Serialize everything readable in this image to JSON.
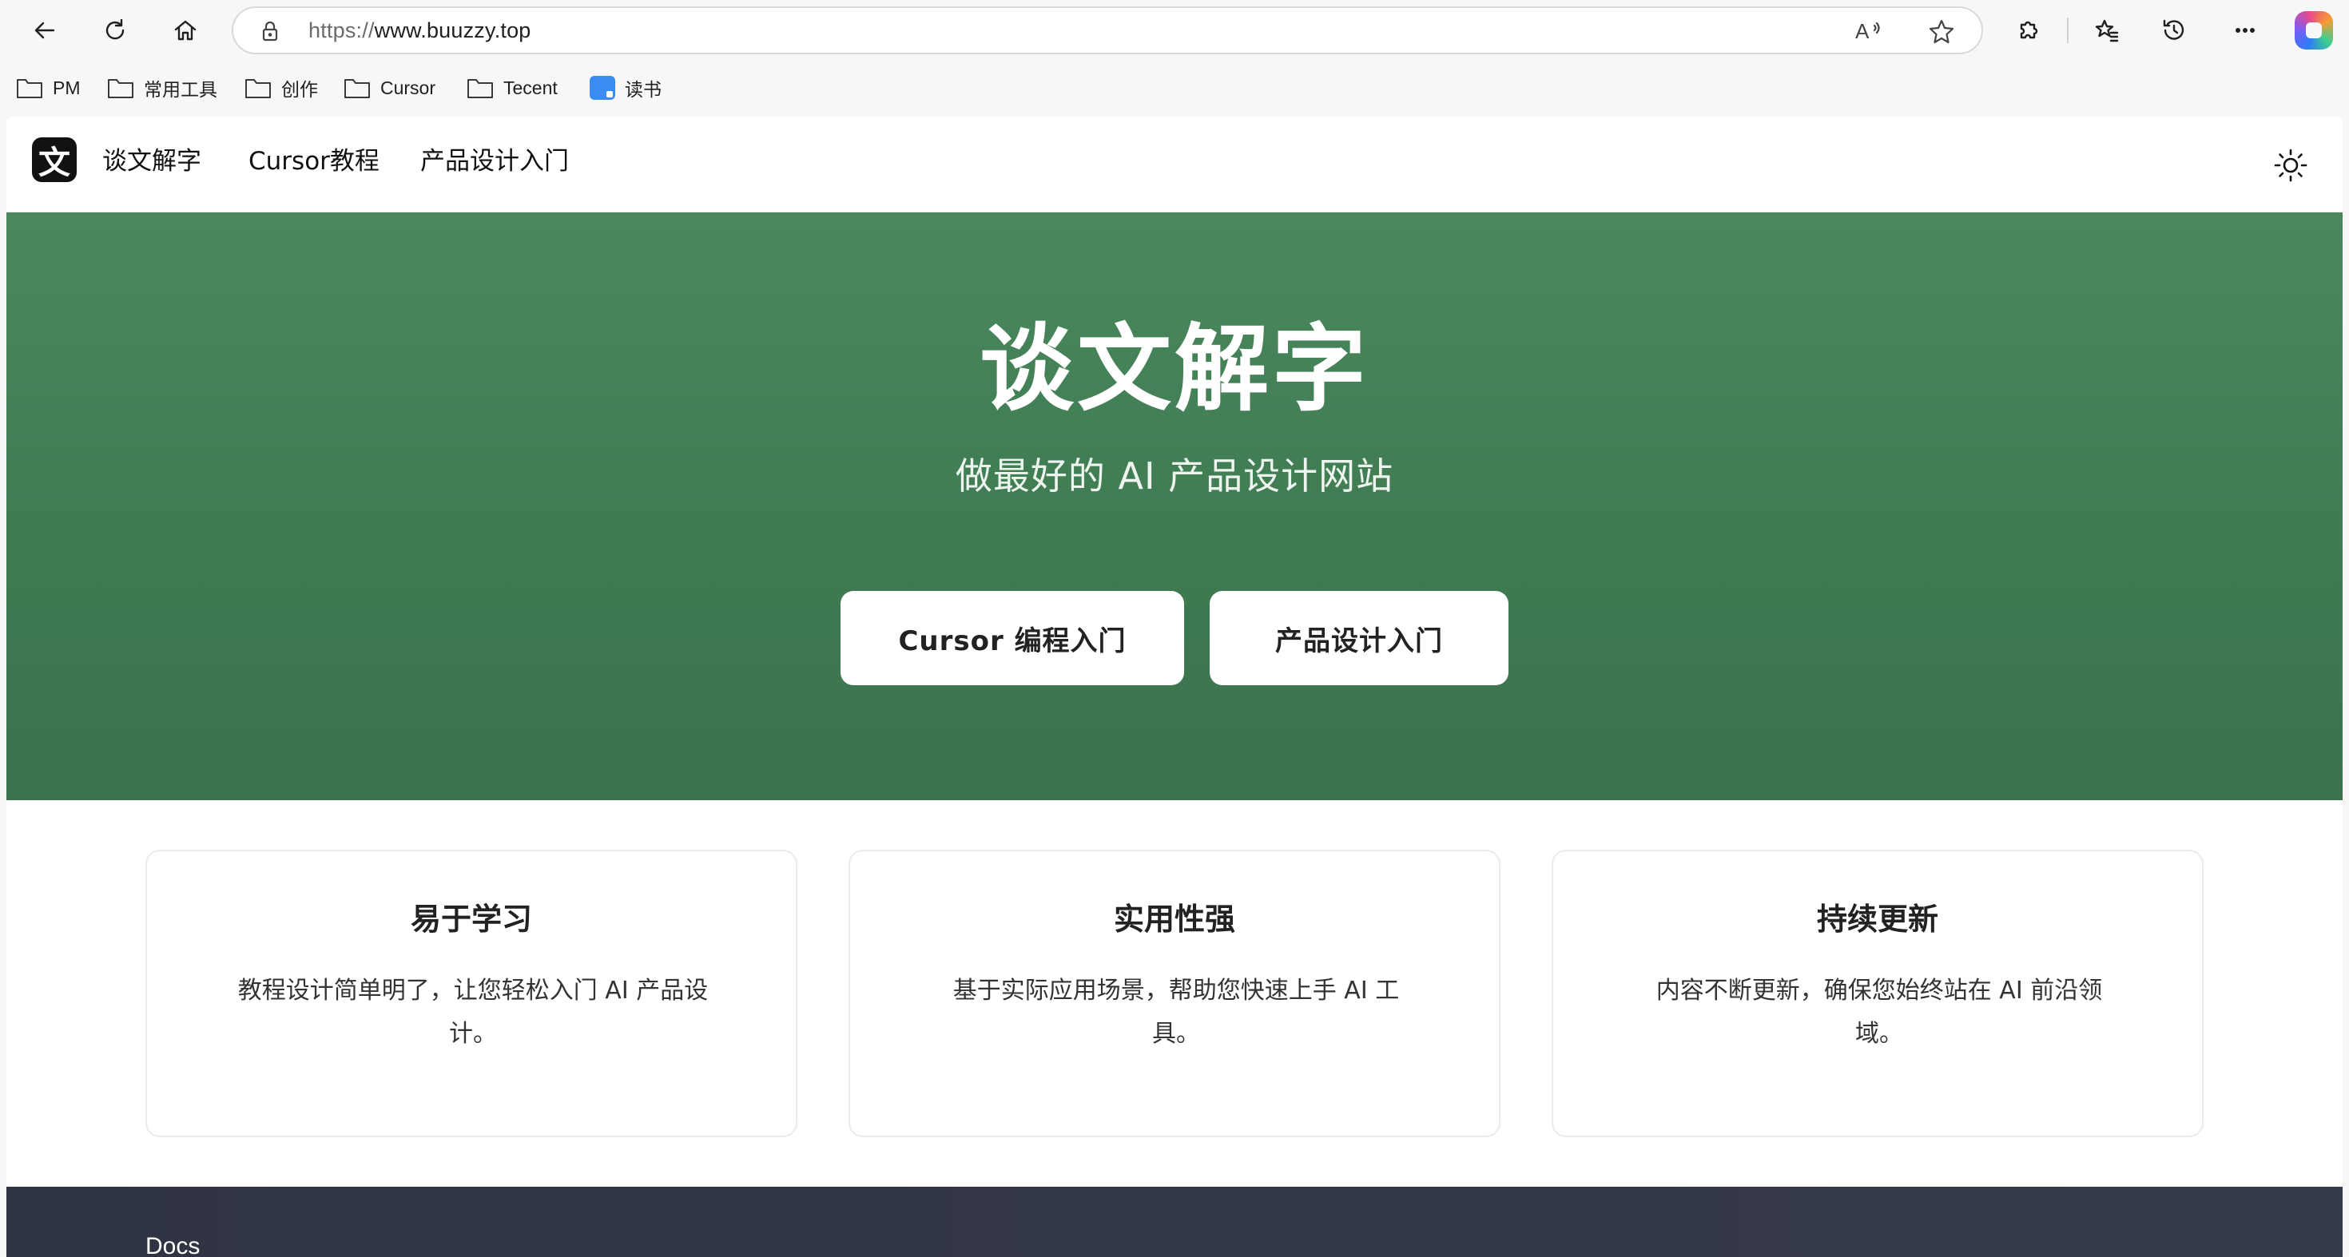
{
  "browser": {
    "url_scheme": "https://",
    "url_host": "www.buuzzy.top",
    "read_aloud_glyph": "A",
    "bookmarks": [
      {
        "label": "PM",
        "icon": "folder-icon"
      },
      {
        "label": "常用工具",
        "icon": "folder-icon"
      },
      {
        "label": "创作",
        "icon": "folder-icon"
      },
      {
        "label": "Cursor",
        "icon": "folder-icon"
      },
      {
        "label": "Tecent",
        "icon": "folder-icon"
      },
      {
        "label": "读书",
        "icon": "app-icon"
      }
    ]
  },
  "site": {
    "logo_glyph": "文",
    "nav": {
      "brand": "谈文解字",
      "links": [
        "Cursor教程",
        "产品设计入门"
      ]
    },
    "hero": {
      "title": "谈文解字",
      "subtitle": "做最好的 AI 产品设计网站",
      "buttons": [
        "Cursor 编程入门",
        "产品设计入门"
      ],
      "background_color": "#437f56"
    },
    "features": [
      {
        "title": "易于学习",
        "text": "教程设计简单明了，让您轻松入门 AI 产品设计。"
      },
      {
        "title": "实用性强",
        "text": "基于实际应用场景，帮助您快速上手 AI 工具。"
      },
      {
        "title": "持续更新",
        "text": "内容不断更新，确保您始终站在 AI 前沿领域。"
      }
    ],
    "footer": {
      "label": "Docs"
    }
  }
}
